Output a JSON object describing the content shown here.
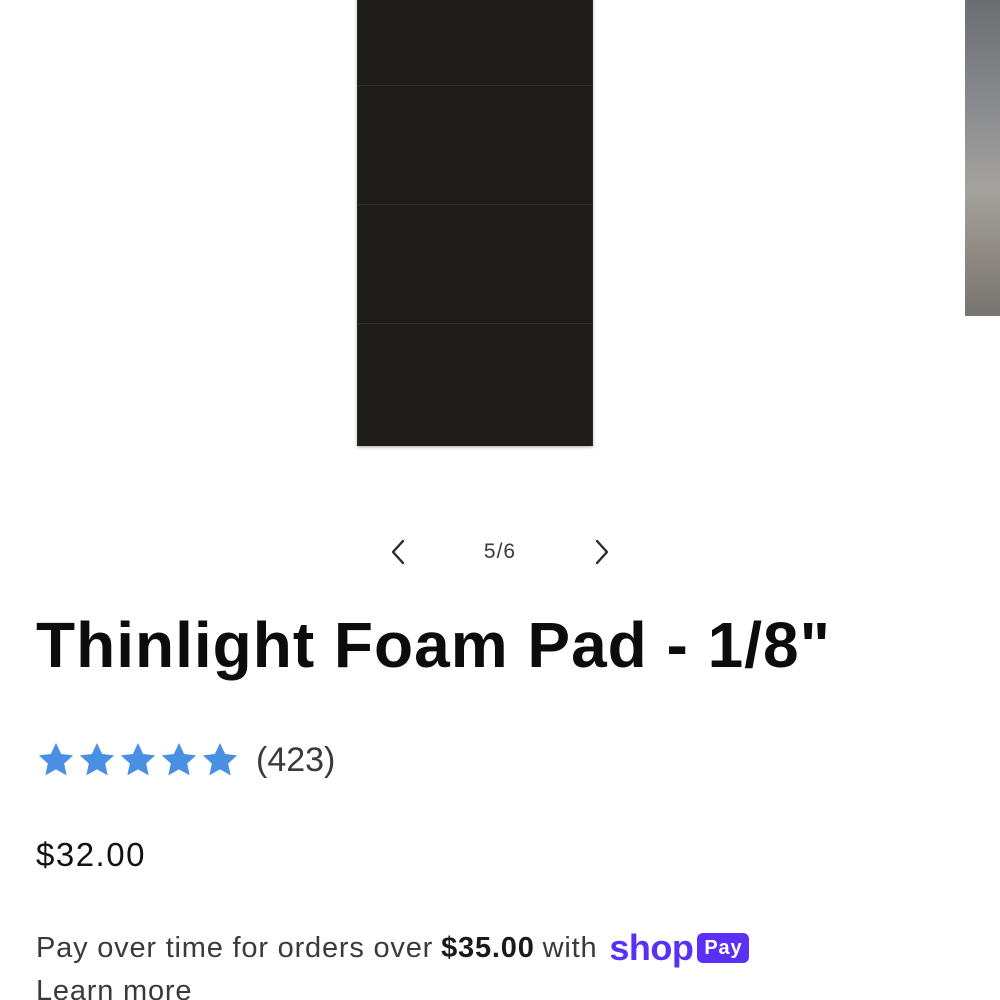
{
  "gallery": {
    "current_slide": "5/6",
    "prev_icon": "chevron-left-icon",
    "next_icon": "chevron-right-icon"
  },
  "product": {
    "title": "Thinlight Foam Pad - 1/8\"",
    "rating_stars": 5,
    "review_count": "(423)",
    "price": "$32.00"
  },
  "installments": {
    "text_before": "Pay over time for orders over",
    "threshold": "$35.00",
    "text_after": "with",
    "brand": "shop",
    "badge": "Pay",
    "learn_more": "Learn more"
  },
  "colors": {
    "star": "#4a90e2",
    "shop_pay": "#5a31f4"
  }
}
